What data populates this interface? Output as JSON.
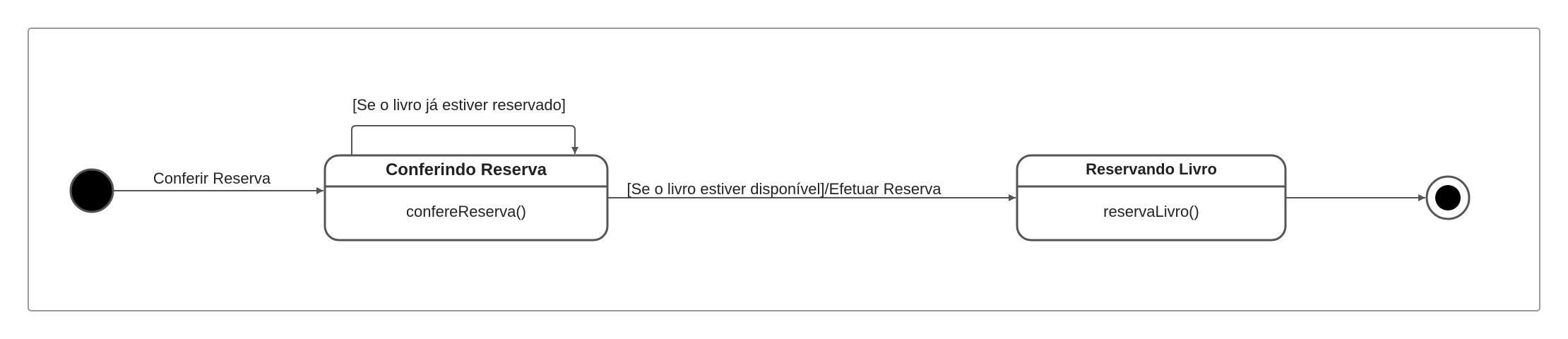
{
  "diagram": {
    "transitions": {
      "initial_to_checking": {
        "label": "Conferir Reserva"
      },
      "self_loop": {
        "label": "[Se o livro já estiver reservado]"
      },
      "checking_to_reserving": {
        "label": "[Se o livro estiver disponível]/Efetuar Reserva"
      }
    },
    "states": {
      "checking": {
        "title": "Conferindo Reserva",
        "action": "confereReserva()"
      },
      "reserving": {
        "title": "Reservando Livro",
        "action": "reservaLivro()"
      }
    },
    "colors": {
      "stroke": "#555555",
      "frame": "#9a9a9a",
      "text": "#222222",
      "node_fill": "#000000"
    }
  }
}
